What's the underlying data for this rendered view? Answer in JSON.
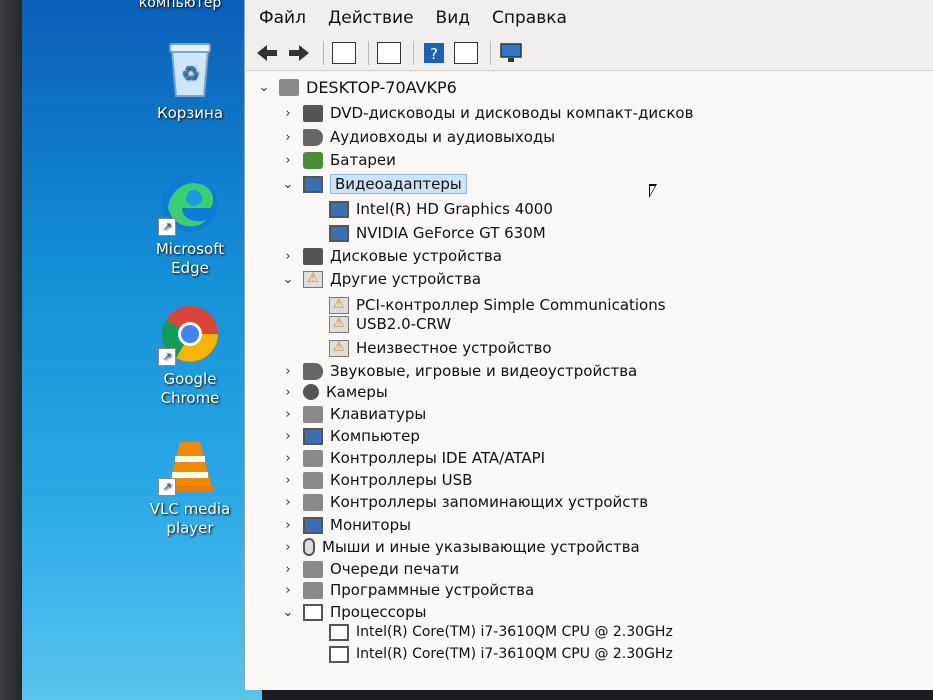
{
  "desktop": {
    "top_label": "компьютер",
    "icons": [
      {
        "label": "Корзина",
        "icon": "recycle-bin-icon"
      },
      {
        "label": "Microsoft Edge",
        "icon": "edge-icon"
      },
      {
        "label": "Google Chrome",
        "icon": "chrome-icon"
      },
      {
        "label": "VLC media player",
        "icon": "vlc-icon"
      }
    ]
  },
  "menubar": {
    "file": "Файл",
    "action": "Действие",
    "view": "Вид",
    "help": "Справка"
  },
  "toolbar": {
    "buttons": [
      "back-arrow-icon",
      "forward-arrow-icon",
      "properties-icon",
      "update-driver-icon",
      "help-icon",
      "view-icon",
      "monitor-icon"
    ]
  },
  "tree": {
    "root": "DESKTOP-70AVKP6",
    "items": [
      {
        "label": "DVD-дисководы и дисководы компакт-дисков",
        "expanded": false
      },
      {
        "label": "Аудиовходы и аудиовыходы",
        "expanded": false
      },
      {
        "label": "Батареи",
        "expanded": false
      },
      {
        "label": "Видеоадаптеры",
        "expanded": true,
        "selected": true
      },
      {
        "label": "Intel(R) HD Graphics 4000",
        "child": true
      },
      {
        "label": "NVIDIA GeForce GT 630M",
        "child": true
      },
      {
        "label": "Дисковые устройства",
        "expanded": false
      },
      {
        "label": "Другие устройства",
        "expanded": true
      },
      {
        "label": "PCI-контроллер Simple Communications",
        "child": true,
        "warning": true
      },
      {
        "label": "USB2.0-CRW",
        "child": true,
        "warning": true
      },
      {
        "label": "Неизвестное устройство",
        "child": true,
        "warning": true
      },
      {
        "label": "Звуковые, игровые и видеоустройства",
        "expanded": false
      },
      {
        "label": "Камеры",
        "expanded": false
      },
      {
        "label": "Клавиатуры",
        "expanded": false
      },
      {
        "label": "Компьютер",
        "expanded": false
      },
      {
        "label": "Контроллеры IDE ATA/ATAPI",
        "expanded": false
      },
      {
        "label": "Контроллеры USB",
        "expanded": false
      },
      {
        "label": "Контроллеры запоминающих устройств",
        "expanded": false
      },
      {
        "label": "Мониторы",
        "expanded": false
      },
      {
        "label": "Мыши и иные указывающие устройства",
        "expanded": false
      },
      {
        "label": "Очереди печати",
        "expanded": false
      },
      {
        "label": "Программные устройства",
        "expanded": false
      },
      {
        "label": "Процессоры",
        "expanded": true
      },
      {
        "label": "Intel(R) Core(TM) i7-3610QM CPU @ 2.30GHz",
        "child": true
      },
      {
        "label": "Intel(R) Core(TM) i7-3610QM CPU @ 2.30GHz",
        "child": true
      }
    ]
  }
}
